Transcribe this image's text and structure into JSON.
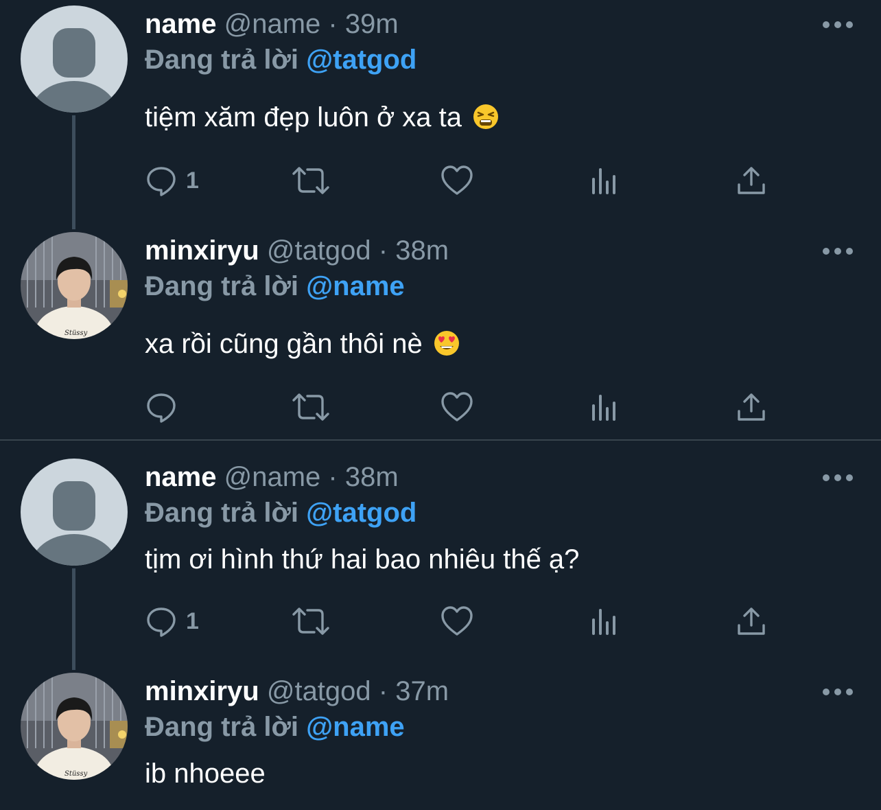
{
  "threads": [
    {
      "tweets": [
        {
          "name": "name",
          "handle": "@name",
          "separator": "·",
          "time": "39m",
          "replying_prefix": "Đang trả lời",
          "replying_to": "@tatgod",
          "text": "tiệm xăm đẹp luôn ở xa ta",
          "emoji": "tired-face-emoji",
          "avatar": "default-avatar-icon",
          "reply_count": "1"
        },
        {
          "name": "minxiryu",
          "handle": "@tatgod",
          "separator": "·",
          "time": "38m",
          "replying_prefix": "Đang trả lời",
          "replying_to": "@name",
          "text": "xa rồi cũng gần thôi nè",
          "emoji": "heart-eyes-emoji",
          "avatar": "profile-photo",
          "reply_count": ""
        }
      ]
    },
    {
      "tweets": [
        {
          "name": "name",
          "handle": "@name",
          "separator": "·",
          "time": "38m",
          "replying_prefix": "Đang trả lời",
          "replying_to": "@tatgod",
          "text": "tịm ơi hình thứ hai bao nhiêu thế ạ?",
          "avatar": "default-avatar-icon",
          "reply_count": "1"
        },
        {
          "name": "minxiryu",
          "handle": "@tatgod",
          "separator": "·",
          "time": "37m",
          "replying_prefix": "Đang trả lời",
          "replying_to": "@name",
          "text": "ib nhoeee",
          "avatar": "profile-photo"
        }
      ]
    }
  ],
  "colors": {
    "background": "#15202b",
    "primary_text": "#ffffff",
    "secondary_text": "#8899a6",
    "accent": "#3ea2f5",
    "divider": "#38444d"
  }
}
